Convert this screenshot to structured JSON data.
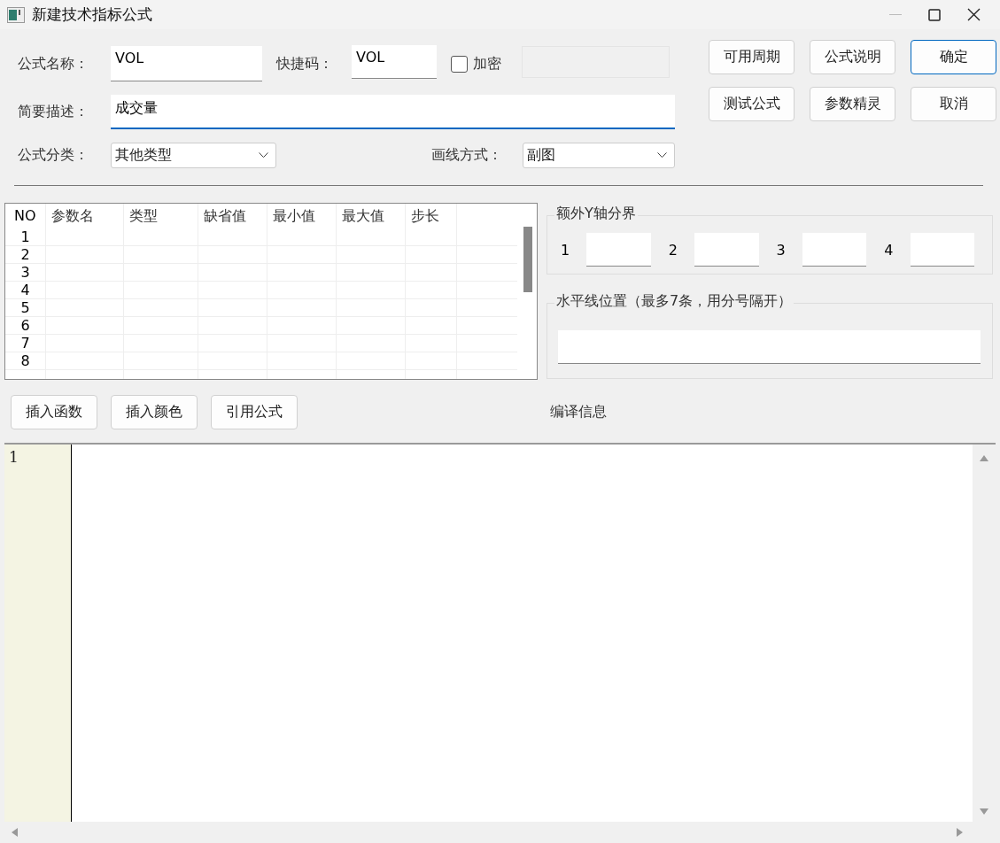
{
  "window": {
    "title": "新建技术指标公式"
  },
  "form": {
    "name_label": "公式名称：",
    "name_value": "VOL",
    "shortcut_label": "快捷码：",
    "shortcut_value": "VOL",
    "encrypt": {
      "label": "加密",
      "checked": false
    },
    "description_label": "简要描述：",
    "description_value": "成交量",
    "category_label": "公式分类：",
    "category_value": "其他类型",
    "draw_mode_label": "画线方式：",
    "draw_mode_value": "副图"
  },
  "buttons": [
    {
      "label": "可用周期",
      "default": false
    },
    {
      "label": "公式说明",
      "default": false
    },
    {
      "label": "确定",
      "default": true
    },
    {
      "label": "测试公式",
      "default": false
    },
    {
      "label": "参数精灵",
      "default": false
    },
    {
      "label": "取消",
      "default": false
    }
  ],
  "param_table": {
    "columns": [
      "NO",
      "参数名",
      "类型",
      "缺省值",
      "最小值",
      "最大值",
      "步长"
    ],
    "rows": [
      "1",
      "2",
      "3",
      "4",
      "5",
      "6",
      "7",
      "8"
    ]
  },
  "y_axis_group": {
    "title": "额外Y轴分界",
    "fields": [
      {
        "label": "1"
      },
      {
        "label": "2"
      },
      {
        "label": "3"
      },
      {
        "label": "4"
      }
    ]
  },
  "hline_group": {
    "title": "水平线位置（最多7条，用分号隔开）"
  },
  "editor_buttons": [
    "插入函数",
    "插入颜色",
    "引用公式"
  ],
  "compile_info_label": "编译信息",
  "editor": {
    "line_numbers": [
      "1"
    ]
  }
}
